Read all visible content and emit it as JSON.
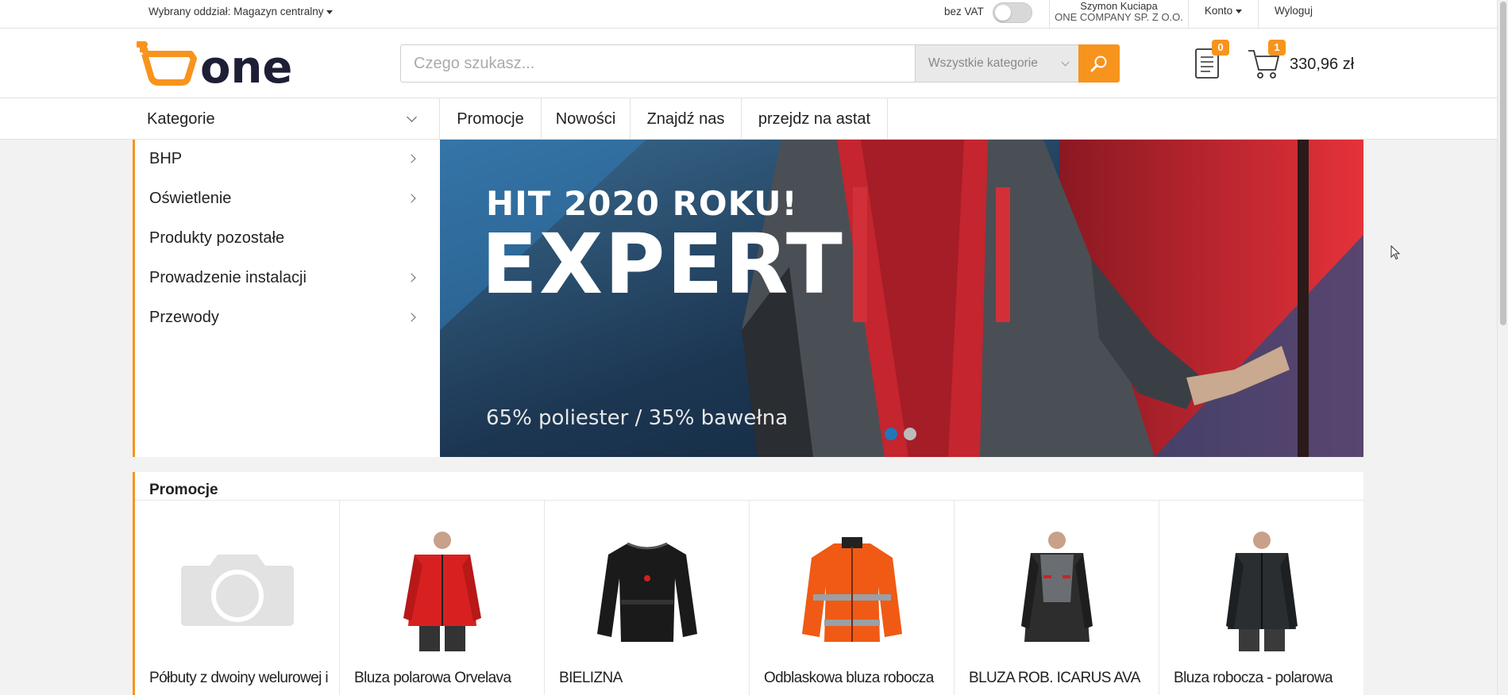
{
  "topbar": {
    "branch": "Wybrany oddział: Magazyn centralny",
    "vat_label": "bez VAT",
    "user_name": "Szymon Kuciapa",
    "company": "ONE COMPANY SP. Z O.O.",
    "account": "Konto",
    "logout": "Wyloguj"
  },
  "header": {
    "logo_text": "one",
    "search_placeholder": "Czego szukasz...",
    "category_select": "Wszystkie kategorie",
    "doc_badge": "0",
    "cart_badge": "1",
    "cart_total": "330,96 zł"
  },
  "nav": {
    "categories": "Kategorie",
    "links": [
      "Promocje",
      "Nowości",
      "Znajdź nas",
      "przejdz na astat"
    ]
  },
  "sidebar": {
    "items": [
      {
        "label": "BHP",
        "has_children": true
      },
      {
        "label": "Oświetlenie",
        "has_children": true
      },
      {
        "label": "Produkty pozostałe",
        "has_children": false
      },
      {
        "label": "Prowadzenie instalacji",
        "has_children": true
      },
      {
        "label": "Przewody",
        "has_children": true
      }
    ]
  },
  "banner": {
    "headline": "HIT 2020 ROKU!",
    "title": "EXPERT",
    "composition": "65% poliester / 35% bawełna",
    "slides": 2,
    "active_slide": 1
  },
  "promotions": {
    "title": "Promocje",
    "products": [
      {
        "name": "Półbuty z dwoiny welurowej i",
        "image": "camera-placeholder-icon"
      },
      {
        "name": "Bluza polarowa Orvelava",
        "image": "red-softshell-jacket",
        "color": "#d82020"
      },
      {
        "name": "BIELIZNA",
        "image": "black-thermal-shirt",
        "color": "#1a1a1a"
      },
      {
        "name": "Odblaskowa bluza robocza",
        "image": "orange-reflective-fleece",
        "color": "#f05a14"
      },
      {
        "name": "BLUZA ROB. ICARUS AVA",
        "image": "grey-work-jacket",
        "color": "#444444"
      },
      {
        "name": "Bluza robocza - polarowa",
        "image": "dark-fleece-jacket",
        "color": "#2a2e30"
      }
    ]
  },
  "colors": {
    "accent": "#f7941d",
    "logo_dark": "#1e1e36"
  }
}
